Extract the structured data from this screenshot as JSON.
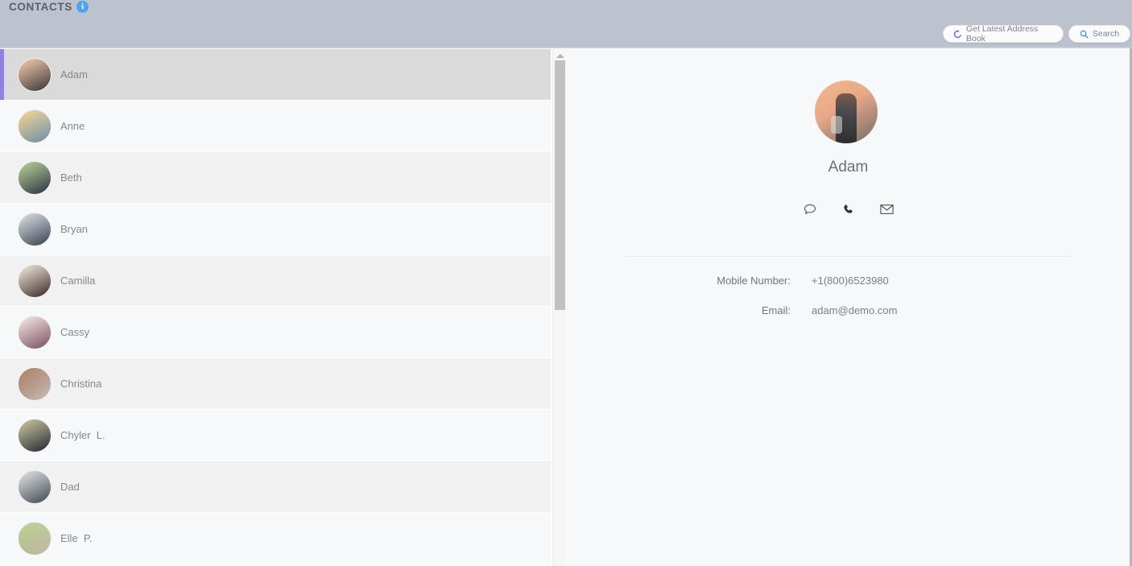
{
  "topbar": {
    "title": "CONTACTS",
    "info_icon": "info-icon",
    "refresh_label": "Get Latest Address Book",
    "refresh_icon": "refresh-icon",
    "search_label": "Search",
    "search_icon": "search-icon",
    "background": "#bcc2ce"
  },
  "list": {
    "selected_accent": "#8b82ea",
    "selected_index": 0,
    "items": [
      {
        "name": "Adam",
        "avatar_from": "#f2b98d",
        "avatar_to": "#3a3a3c"
      },
      {
        "name": "Anne",
        "avatar_from": "#f2c66a",
        "avatar_to": "#7ba7d0"
      },
      {
        "name": "Beth",
        "avatar_from": "#9dc06a",
        "avatar_to": "#2c3553"
      },
      {
        "name": "Bryan",
        "avatar_from": "#cfd6dc",
        "avatar_to": "#3c4758"
      },
      {
        "name": "Camilla",
        "avatar_from": "#f0e2d2",
        "avatar_to": "#3b2a25"
      },
      {
        "name": "Cassy",
        "avatar_from": "#f6dfe0",
        "avatar_to": "#8b5b6a"
      },
      {
        "name": "Christina",
        "avatar_from": "#8a4a2a",
        "avatar_to": "#efe6df"
      },
      {
        "name": "Chyler  L.",
        "avatar_from": "#b9b27a",
        "avatar_to": "#23283a"
      },
      {
        "name": "Dad",
        "avatar_from": "#d7d9da",
        "avatar_to": "#46505c"
      },
      {
        "name": "Elle  P.",
        "avatar_from": "#9fbf63",
        "avatar_to": "#e6d9c6"
      }
    ]
  },
  "scrollbar": {
    "up_arrow": "scroll-up-arrow-icon",
    "thumb": "scroll-thumb"
  },
  "detail": {
    "name": "Adam",
    "avatar": "contact-avatar-adam",
    "actions": [
      {
        "icon": "chat-icon",
        "name": "message-action"
      },
      {
        "icon": "phone-icon",
        "name": "call-action"
      },
      {
        "icon": "mail-icon",
        "name": "email-action"
      }
    ],
    "fields": [
      {
        "label": "Mobile Number:",
        "value": "+1(800)6523980"
      },
      {
        "label": "Email:",
        "value": "adam@demo.com"
      }
    ]
  }
}
